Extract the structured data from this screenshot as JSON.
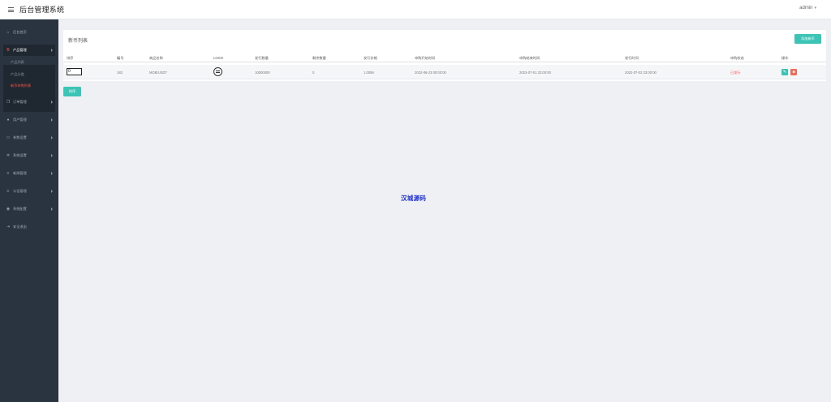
{
  "header": {
    "app_title": "后台管理系统",
    "user": "admin"
  },
  "sidebar": {
    "items": [
      {
        "label": "后台首页",
        "icon": "home-icon",
        "has_arrow": false
      },
      {
        "label": "产品管理",
        "icon": "bitcoin-icon",
        "has_arrow": true,
        "active": true
      },
      {
        "label": "订单管理",
        "icon": "copy-icon",
        "has_arrow": true
      },
      {
        "label": "用户管理",
        "icon": "user-icon",
        "has_arrow": true
      },
      {
        "label": "参数设置",
        "icon": "file-icon",
        "has_arrow": true
      },
      {
        "label": "系统设置",
        "icon": "gears-icon",
        "has_arrow": true
      },
      {
        "label": "新闻管理",
        "icon": "list-icon",
        "has_arrow": true
      },
      {
        "label": "公告管理",
        "icon": "list-icon",
        "has_arrow": true
      },
      {
        "label": "系统配置",
        "icon": "globe-icon",
        "has_arrow": true
      },
      {
        "label": "安全退出",
        "icon": "logout-icon",
        "has_arrow": false
      }
    ],
    "submenu": [
      {
        "label": "产品列表"
      },
      {
        "label": "产品分类"
      },
      {
        "label": "新币申购列表",
        "current": true
      }
    ]
  },
  "main": {
    "card_title": "新币列表",
    "add_button": "添加新币",
    "table": {
      "columns": [
        "排序",
        "编号",
        "商品名称",
        "LOGO",
        "发行数量",
        "剩余数量",
        "发行价格",
        "申购开始时间",
        "申购结束时间",
        "发行时间",
        "申购状态",
        "操作"
      ],
      "rows": [
        {
          "sort": "0",
          "id": "182",
          "name": "MOB/USDT",
          "logo": "logo-icon",
          "issue_qty": "10000000",
          "remaining_qty": "0",
          "price": "1.0056",
          "start_time": "2022-06-23 00:00:00",
          "end_time": "2022-07-01 23:00:00",
          "issue_time": "2022-07-02 23:00:00",
          "status": "已发行"
        }
      ]
    },
    "sort_button": "排序"
  },
  "watermark": "汉城源码",
  "colors": {
    "accent": "#3cc4b6",
    "danger": "#f06b5a",
    "status_red": "#ff4d4d",
    "sidebar_bg": "#2a3340",
    "watermark": "#1c2fd4"
  }
}
